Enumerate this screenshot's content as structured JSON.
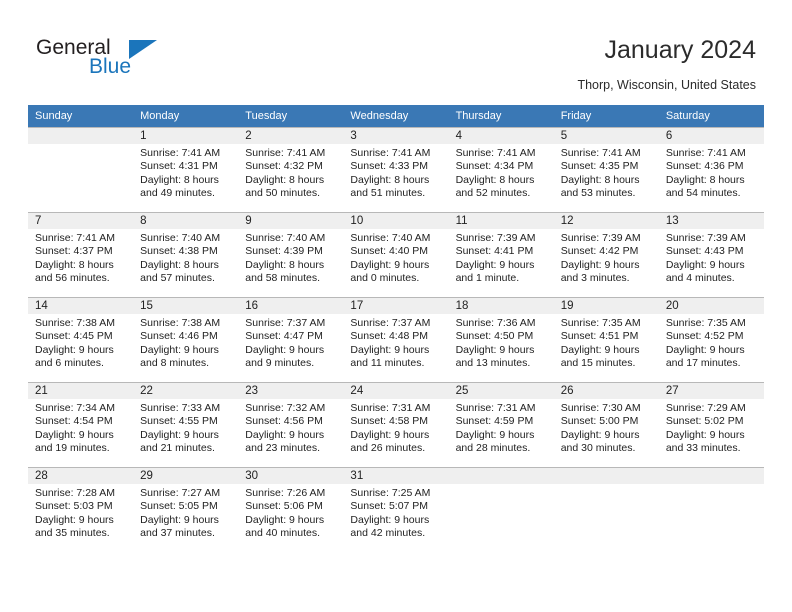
{
  "brand": {
    "name_top": "General",
    "name_bottom": "Blue",
    "accent_color": "#1b75bb"
  },
  "header": {
    "title": "January 2024",
    "subtitle": "Thorp, Wisconsin, United States"
  },
  "theme": {
    "header_row_bg": "#3a78b5",
    "header_row_text": "#ffffff",
    "daynum_band_bg": "#efefef",
    "grid_line": "#b8b8b8",
    "cell_bg": "#ffffff"
  },
  "weekday_headers": [
    "Sunday",
    "Monday",
    "Tuesday",
    "Wednesday",
    "Thursday",
    "Friday",
    "Saturday"
  ],
  "weeks": [
    [
      {
        "day": "",
        "lines": [
          "",
          "",
          "",
          ""
        ]
      },
      {
        "day": "1",
        "lines": [
          "Sunrise: 7:41 AM",
          "Sunset: 4:31 PM",
          "Daylight: 8 hours",
          "and 49 minutes."
        ]
      },
      {
        "day": "2",
        "lines": [
          "Sunrise: 7:41 AM",
          "Sunset: 4:32 PM",
          "Daylight: 8 hours",
          "and 50 minutes."
        ]
      },
      {
        "day": "3",
        "lines": [
          "Sunrise: 7:41 AM",
          "Sunset: 4:33 PM",
          "Daylight: 8 hours",
          "and 51 minutes."
        ]
      },
      {
        "day": "4",
        "lines": [
          "Sunrise: 7:41 AM",
          "Sunset: 4:34 PM",
          "Daylight: 8 hours",
          "and 52 minutes."
        ]
      },
      {
        "day": "5",
        "lines": [
          "Sunrise: 7:41 AM",
          "Sunset: 4:35 PM",
          "Daylight: 8 hours",
          "and 53 minutes."
        ]
      },
      {
        "day": "6",
        "lines": [
          "Sunrise: 7:41 AM",
          "Sunset: 4:36 PM",
          "Daylight: 8 hours",
          "and 54 minutes."
        ]
      }
    ],
    [
      {
        "day": "7",
        "lines": [
          "Sunrise: 7:41 AM",
          "Sunset: 4:37 PM",
          "Daylight: 8 hours",
          "and 56 minutes."
        ]
      },
      {
        "day": "8",
        "lines": [
          "Sunrise: 7:40 AM",
          "Sunset: 4:38 PM",
          "Daylight: 8 hours",
          "and 57 minutes."
        ]
      },
      {
        "day": "9",
        "lines": [
          "Sunrise: 7:40 AM",
          "Sunset: 4:39 PM",
          "Daylight: 8 hours",
          "and 58 minutes."
        ]
      },
      {
        "day": "10",
        "lines": [
          "Sunrise: 7:40 AM",
          "Sunset: 4:40 PM",
          "Daylight: 9 hours",
          "and 0 minutes."
        ]
      },
      {
        "day": "11",
        "lines": [
          "Sunrise: 7:39 AM",
          "Sunset: 4:41 PM",
          "Daylight: 9 hours",
          "and 1 minute."
        ]
      },
      {
        "day": "12",
        "lines": [
          "Sunrise: 7:39 AM",
          "Sunset: 4:42 PM",
          "Daylight: 9 hours",
          "and 3 minutes."
        ]
      },
      {
        "day": "13",
        "lines": [
          "Sunrise: 7:39 AM",
          "Sunset: 4:43 PM",
          "Daylight: 9 hours",
          "and 4 minutes."
        ]
      }
    ],
    [
      {
        "day": "14",
        "lines": [
          "Sunrise: 7:38 AM",
          "Sunset: 4:45 PM",
          "Daylight: 9 hours",
          "and 6 minutes."
        ]
      },
      {
        "day": "15",
        "lines": [
          "Sunrise: 7:38 AM",
          "Sunset: 4:46 PM",
          "Daylight: 9 hours",
          "and 8 minutes."
        ]
      },
      {
        "day": "16",
        "lines": [
          "Sunrise: 7:37 AM",
          "Sunset: 4:47 PM",
          "Daylight: 9 hours",
          "and 9 minutes."
        ]
      },
      {
        "day": "17",
        "lines": [
          "Sunrise: 7:37 AM",
          "Sunset: 4:48 PM",
          "Daylight: 9 hours",
          "and 11 minutes."
        ]
      },
      {
        "day": "18",
        "lines": [
          "Sunrise: 7:36 AM",
          "Sunset: 4:50 PM",
          "Daylight: 9 hours",
          "and 13 minutes."
        ]
      },
      {
        "day": "19",
        "lines": [
          "Sunrise: 7:35 AM",
          "Sunset: 4:51 PM",
          "Daylight: 9 hours",
          "and 15 minutes."
        ]
      },
      {
        "day": "20",
        "lines": [
          "Sunrise: 7:35 AM",
          "Sunset: 4:52 PM",
          "Daylight: 9 hours",
          "and 17 minutes."
        ]
      }
    ],
    [
      {
        "day": "21",
        "lines": [
          "Sunrise: 7:34 AM",
          "Sunset: 4:54 PM",
          "Daylight: 9 hours",
          "and 19 minutes."
        ]
      },
      {
        "day": "22",
        "lines": [
          "Sunrise: 7:33 AM",
          "Sunset: 4:55 PM",
          "Daylight: 9 hours",
          "and 21 minutes."
        ]
      },
      {
        "day": "23",
        "lines": [
          "Sunrise: 7:32 AM",
          "Sunset: 4:56 PM",
          "Daylight: 9 hours",
          "and 23 minutes."
        ]
      },
      {
        "day": "24",
        "lines": [
          "Sunrise: 7:31 AM",
          "Sunset: 4:58 PM",
          "Daylight: 9 hours",
          "and 26 minutes."
        ]
      },
      {
        "day": "25",
        "lines": [
          "Sunrise: 7:31 AM",
          "Sunset: 4:59 PM",
          "Daylight: 9 hours",
          "and 28 minutes."
        ]
      },
      {
        "day": "26",
        "lines": [
          "Sunrise: 7:30 AM",
          "Sunset: 5:00 PM",
          "Daylight: 9 hours",
          "and 30 minutes."
        ]
      },
      {
        "day": "27",
        "lines": [
          "Sunrise: 7:29 AM",
          "Sunset: 5:02 PM",
          "Daylight: 9 hours",
          "and 33 minutes."
        ]
      }
    ],
    [
      {
        "day": "28",
        "lines": [
          "Sunrise: 7:28 AM",
          "Sunset: 5:03 PM",
          "Daylight: 9 hours",
          "and 35 minutes."
        ]
      },
      {
        "day": "29",
        "lines": [
          "Sunrise: 7:27 AM",
          "Sunset: 5:05 PM",
          "Daylight: 9 hours",
          "and 37 minutes."
        ]
      },
      {
        "day": "30",
        "lines": [
          "Sunrise: 7:26 AM",
          "Sunset: 5:06 PM",
          "Daylight: 9 hours",
          "and 40 minutes."
        ]
      },
      {
        "day": "31",
        "lines": [
          "Sunrise: 7:25 AM",
          "Sunset: 5:07 PM",
          "Daylight: 9 hours",
          "and 42 minutes."
        ]
      },
      {
        "day": "",
        "lines": [
          "",
          "",
          "",
          ""
        ]
      },
      {
        "day": "",
        "lines": [
          "",
          "",
          "",
          ""
        ]
      },
      {
        "day": "",
        "lines": [
          "",
          "",
          "",
          ""
        ]
      }
    ]
  ]
}
